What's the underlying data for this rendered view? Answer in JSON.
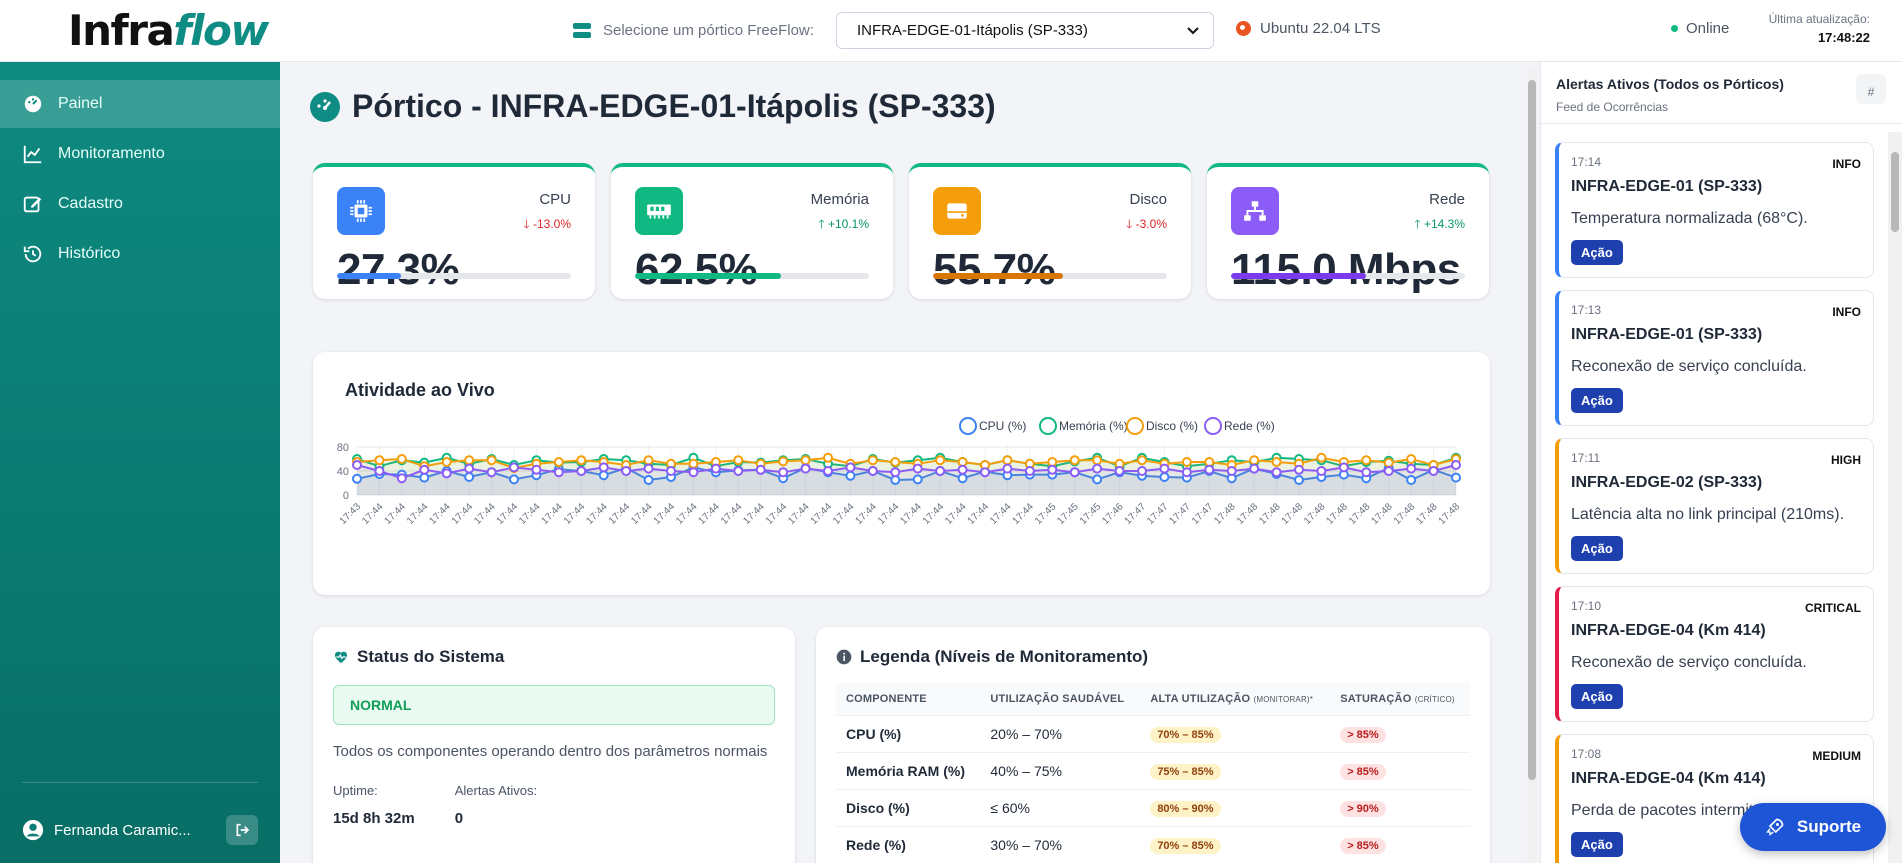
{
  "brand": {
    "part1": "Infra",
    "part2": "flow"
  },
  "header": {
    "select_label": "Selecione um pórtico FreeFlow:",
    "selected_portico": "INFRA-EDGE-01-Itápolis (SP-333)",
    "os": "Ubuntu 22.04 LTS",
    "status": "Online",
    "last_update_label": "Última atualização:",
    "last_update_time": "17:48:22"
  },
  "sidebar": {
    "items": [
      {
        "label": "Painel",
        "icon": "dashboard-icon",
        "active": true
      },
      {
        "label": "Monitoramento",
        "icon": "chart-line-icon",
        "active": false
      },
      {
        "label": "Cadastro",
        "icon": "edit-icon",
        "active": false
      },
      {
        "label": "Histórico",
        "icon": "history-icon",
        "active": false
      }
    ],
    "user": "Fernanda Caramic..."
  },
  "page": {
    "title": "Pórtico  - INFRA-EDGE-01-Itápolis (SP-333)"
  },
  "metrics": [
    {
      "name": "CPU",
      "change": "-13.0%",
      "direction": "down",
      "value": "27.3%",
      "fill": 0.273,
      "color": "#3b82f6",
      "icon": "cpu-icon"
    },
    {
      "name": "Memória",
      "change": "+10.1%",
      "direction": "up",
      "value": "62.5%",
      "fill": 0.625,
      "color": "#10b981",
      "icon": "memory-icon"
    },
    {
      "name": "Disco",
      "change": "-3.0%",
      "direction": "down",
      "value": "55.7%",
      "fill": 0.557,
      "color": "#f59e0b",
      "icon": "disk-icon"
    },
    {
      "name": "Rede",
      "change": "+14.3%",
      "direction": "up",
      "value": "115.0 Mbps",
      "fill": 0.575,
      "color": "#8b5cf6",
      "icon": "network-icon"
    }
  ],
  "chart_title": "Atividade ao Vivo",
  "chart_data": {
    "type": "line",
    "title": "Atividade ao Vivo",
    "ylim": [
      0,
      80
    ],
    "yticks": [
      0,
      40,
      80
    ],
    "grid": true,
    "legend_placement": "top-right",
    "x": [
      "17:43",
      "17:44",
      "17:44",
      "17:44",
      "17:44",
      "17:44",
      "17:44",
      "17:44",
      "17:44",
      "17:44",
      "17:44",
      "17:44",
      "17:44",
      "17:44",
      "17:44",
      "17:44",
      "17:44",
      "17:44",
      "17:44",
      "17:44",
      "17:44",
      "17:44",
      "17:44",
      "17:44",
      "17:44",
      "17:44",
      "17:44",
      "17:44",
      "17:44",
      "17:44",
      "17:44",
      "17:45",
      "17:45",
      "17:45",
      "17:46",
      "17:47",
      "17:47",
      "17:47",
      "17:47",
      "17:48",
      "17:48",
      "17:48",
      "17:48",
      "17:48",
      "17:48",
      "17:48",
      "17:48",
      "17:48",
      "17:48",
      "17:48"
    ],
    "series": [
      {
        "name": "CPU (%)",
        "color": "#3b82f6",
        "values": [
          27,
          35,
          34,
          29,
          40,
          30,
          38,
          26,
          33,
          43,
          40,
          33,
          45,
          25,
          30,
          46,
          38,
          41,
          42,
          28,
          45,
          38,
          32,
          40,
          25,
          26,
          40,
          28,
          39,
          33,
          34,
          34,
          38,
          26,
          38,
          32,
          30,
          29,
          40,
          28,
          44,
          35,
          25,
          30,
          34,
          28,
          45,
          25,
          42,
          29
        ]
      },
      {
        "name": "Memória (%)",
        "color": "#10b981",
        "values": [
          60,
          48,
          58,
          54,
          62,
          52,
          60,
          50,
          58,
          54,
          55,
          60,
          58,
          52,
          50,
          62,
          48,
          55,
          54,
          58,
          60,
          52,
          48,
          60,
          54,
          58,
          62,
          55,
          50,
          58,
          52,
          48,
          56,
          62,
          48,
          62,
          55,
          48,
          52,
          58,
          55,
          62,
          60,
          58,
          48,
          55,
          57,
          52,
          50,
          62
        ]
      },
      {
        "name": "Disco (%)",
        "color": "#f59e0b",
        "values": [
          55,
          58,
          60,
          48,
          55,
          58,
          58,
          45,
          52,
          55,
          58,
          55,
          50,
          58,
          52,
          52,
          55,
          58,
          52,
          56,
          58,
          62,
          52,
          58,
          55,
          52,
          58,
          55,
          50,
          58,
          52,
          55,
          58,
          58,
          52,
          58,
          52,
          55,
          55,
          50,
          58,
          55,
          52,
          62,
          55,
          58,
          54,
          60,
          50,
          60
        ]
      },
      {
        "name": "Rede (%)",
        "color": "#8b5cf6",
        "values": [
          50,
          40,
          28,
          42,
          36,
          44,
          38,
          46,
          42,
          38,
          40,
          46,
          40,
          44,
          40,
          38,
          44,
          40,
          42,
          38,
          44,
          40,
          46,
          40,
          38,
          44,
          40,
          42,
          38,
          44,
          40,
          42,
          38,
          44,
          40,
          40,
          44,
          38,
          42,
          40,
          44,
          38,
          42,
          40,
          46,
          38,
          40,
          44,
          40,
          50
        ]
      }
    ]
  },
  "status": {
    "title": "Status do Sistema",
    "state": "NORMAL",
    "description": "Todos os componentes operando dentro dos parâmetros normais",
    "uptime_label": "Uptime:",
    "uptime_value": "15d 8h 32m",
    "alerts_label": "Alertas Ativos:",
    "alerts_value": "0"
  },
  "legend": {
    "title": "Legenda (Níveis de Monitoramento)",
    "headers": [
      "COMPONENTE",
      "UTILIZAÇÃO SAUDÁVEL",
      "ALTA UTILIZAÇÃO",
      "(MONITORAR)*",
      "SATURAÇÃO",
      "(CRÍTICO)"
    ],
    "rows": [
      {
        "component": "CPU (%)",
        "healthy": "20% – 70%",
        "high": "70% – 85%",
        "saturation": "> 85%"
      },
      {
        "component": "Memória RAM (%)",
        "healthy": "40% – 75%",
        "high": "75% – 85%",
        "saturation": "> 85%"
      },
      {
        "component": "Disco (%)",
        "healthy": "≤ 60%",
        "high": "80% – 90%",
        "saturation": "> 90%"
      },
      {
        "component": "Rede (%)",
        "healthy": "30% – 70%",
        "high": "70% – 85%",
        "saturation": "> 85%"
      }
    ]
  },
  "alerts": {
    "title": "Alertas Ativos (Todos os Pórticos)",
    "subtitle": "Feed de Ocorrências",
    "items": [
      {
        "time": "17:14",
        "severity": "INFO",
        "title": "INFRA-EDGE-01 (SP-333)",
        "desc": "Temperatura normalizada (68°C).",
        "action": "Ação",
        "color": "#3b82f6"
      },
      {
        "time": "17:13",
        "severity": "INFO",
        "title": "INFRA-EDGE-01 (SP-333)",
        "desc": "Reconexão de serviço concluída.",
        "action": "Ação",
        "color": "#3b82f6"
      },
      {
        "time": "17:11",
        "severity": "HIGH",
        "title": "INFRA-EDGE-02 (SP-333)",
        "desc": "Latência alta no link principal (210ms).",
        "action": "Ação",
        "color": "#f59e0b"
      },
      {
        "time": "17:10",
        "severity": "CRITICAL",
        "title": "INFRA-EDGE-04 (Km 414)",
        "desc": "Reconexão de serviço concluída.",
        "action": "Ação",
        "color": "#e11d48"
      },
      {
        "time": "17:08",
        "severity": "MEDIUM",
        "title": "INFRA-EDGE-04 (Km 414)",
        "desc": "Perda de pacotes intermitente (2.5%).",
        "action": "Ação",
        "color": "#f59e0b"
      }
    ]
  },
  "support_label": "Suporte"
}
